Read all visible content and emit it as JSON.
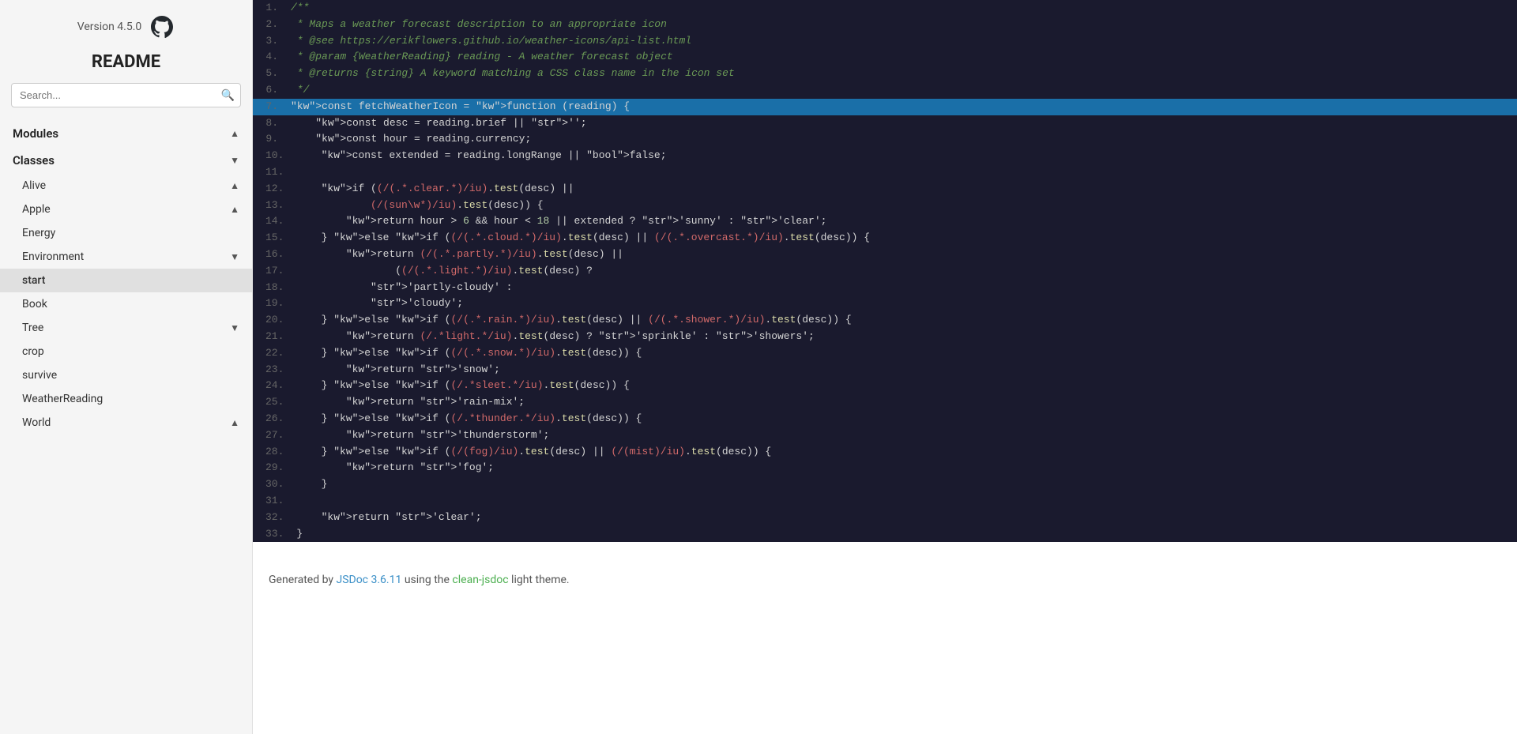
{
  "sidebar": {
    "version": "Version 4.5.0",
    "readme_label": "README",
    "search_placeholder": "Search...",
    "sections": [
      {
        "id": "modules",
        "label": "Modules",
        "expanded": true,
        "chevron": "▲",
        "items": []
      },
      {
        "id": "classes",
        "label": "Classes",
        "expanded": true,
        "chevron": "▼",
        "items": [
          {
            "id": "alive",
            "label": "Alive",
            "expandable": true,
            "chevron": "▲",
            "active": false
          },
          {
            "id": "apple",
            "label": "Apple",
            "expandable": true,
            "chevron": "▲",
            "active": false
          },
          {
            "id": "energy",
            "label": "Energy",
            "expandable": false,
            "active": false
          },
          {
            "id": "environment",
            "label": "Environment",
            "expandable": true,
            "chevron": "▼",
            "active": false
          },
          {
            "id": "start",
            "label": "start",
            "expandable": false,
            "active": true
          },
          {
            "id": "book",
            "label": "Book",
            "expandable": false,
            "active": false
          },
          {
            "id": "tree",
            "label": "Tree",
            "expandable": true,
            "chevron": "▼",
            "active": false
          },
          {
            "id": "crop",
            "label": "crop",
            "expandable": false,
            "active": false
          },
          {
            "id": "survive",
            "label": "survive",
            "expandable": false,
            "active": false
          },
          {
            "id": "weatherreading",
            "label": "WeatherReading",
            "expandable": false,
            "active": false
          },
          {
            "id": "world",
            "label": "World",
            "expandable": true,
            "chevron": "▲",
            "active": false
          }
        ]
      }
    ]
  },
  "code": {
    "lines": [
      {
        "num": 1,
        "content": "/**",
        "highlighted": false
      },
      {
        "num": 2,
        "content": " * Maps a weather forecast description to an appropriate icon",
        "highlighted": false
      },
      {
        "num": 3,
        "content": " * @see https://erikflowers.github.io/weather-icons/api-list.html",
        "highlighted": false
      },
      {
        "num": 4,
        "content": " * @param {WeatherReading} reading - A weather forecast object",
        "highlighted": false
      },
      {
        "num": 5,
        "content": " * @returns {string} A keyword matching a CSS class name in the icon set",
        "highlighted": false
      },
      {
        "num": 6,
        "content": " */",
        "highlighted": false
      },
      {
        "num": 7,
        "content": "const fetchWeatherIcon = function (reading) {",
        "highlighted": true
      },
      {
        "num": 8,
        "content": "    const desc = reading.brief || '';",
        "highlighted": false
      },
      {
        "num": 9,
        "content": "    const hour = reading.currency;",
        "highlighted": false
      },
      {
        "num": 10,
        "content": "    const extended = reading.longRange || false;",
        "highlighted": false
      },
      {
        "num": 11,
        "content": "",
        "highlighted": false
      },
      {
        "num": 12,
        "content": "    if ((/(.*.clear.*)/iu).test(desc) ||",
        "highlighted": false
      },
      {
        "num": 13,
        "content": "            (/(sun\\w*)/iu).test(desc)) {",
        "highlighted": false
      },
      {
        "num": 14,
        "content": "        return hour > 6 && hour < 18 || extended ? 'sunny' : 'clear';",
        "highlighted": false
      },
      {
        "num": 15,
        "content": "    } else if ((/(.*.cloud.*)/iu).test(desc) || (/(.*.overcast.*)/iu).test(desc)) {",
        "highlighted": false
      },
      {
        "num": 16,
        "content": "        return (/(.*.partly.*)/iu).test(desc) ||",
        "highlighted": false
      },
      {
        "num": 17,
        "content": "                ((/(.*.light.*)/iu).test(desc) ?",
        "highlighted": false
      },
      {
        "num": 18,
        "content": "            'partly-cloudy' :",
        "highlighted": false
      },
      {
        "num": 19,
        "content": "            'cloudy';",
        "highlighted": false
      },
      {
        "num": 20,
        "content": "    } else if ((/(.*.rain.*)/iu).test(desc) || (/(.*.shower.*)/iu).test(desc)) {",
        "highlighted": false
      },
      {
        "num": 21,
        "content": "        return (/.*light.*/iu).test(desc) ? 'sprinkle' : 'showers';",
        "highlighted": false
      },
      {
        "num": 22,
        "content": "    } else if ((/(.*.snow.*)/iu).test(desc)) {",
        "highlighted": false
      },
      {
        "num": 23,
        "content": "        return 'snow';",
        "highlighted": false
      },
      {
        "num": 24,
        "content": "    } else if ((/.*sleet.*/iu).test(desc)) {",
        "highlighted": false
      },
      {
        "num": 25,
        "content": "        return 'rain-mix';",
        "highlighted": false
      },
      {
        "num": 26,
        "content": "    } else if ((/.*thunder.*/iu).test(desc)) {",
        "highlighted": false
      },
      {
        "num": 27,
        "content": "        return 'thunderstorm';",
        "highlighted": false
      },
      {
        "num": 28,
        "content": "    } else if ((/(fog)/iu).test(desc) || (/(mist)/iu).test(desc)) {",
        "highlighted": false
      },
      {
        "num": 29,
        "content": "        return 'fog';",
        "highlighted": false
      },
      {
        "num": 30,
        "content": "    }",
        "highlighted": false
      },
      {
        "num": 31,
        "content": "",
        "highlighted": false
      },
      {
        "num": 32,
        "content": "    return 'clear';",
        "highlighted": false
      },
      {
        "num": 33,
        "content": "}",
        "highlighted": false
      }
    ]
  },
  "footer": {
    "text_before": "Generated by ",
    "jsdoc_label": "JSDoc 3.6.11",
    "jsdoc_url": "#",
    "text_middle": " using the ",
    "theme_label": "clean-jsdoc",
    "theme_url": "#",
    "text_after": " light theme."
  }
}
